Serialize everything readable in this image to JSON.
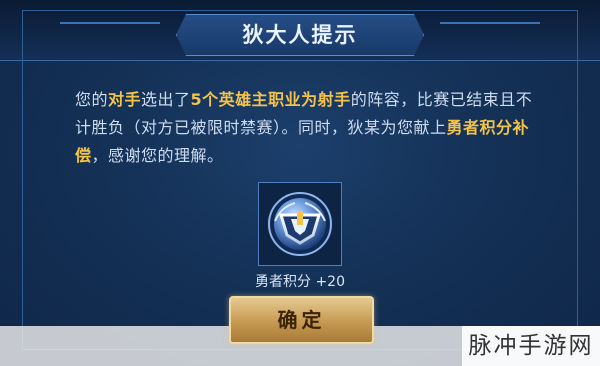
{
  "dialog": {
    "title": "狄大人提示",
    "message": {
      "p1": "您的",
      "h1": "对手",
      "p2": "选出了",
      "h2": "5个英雄主职业为射手",
      "p3": "的阵容，比赛已结束且不计胜负（对方已被限时禁赛）。同时，狄某为您献上",
      "h3": "勇者积分补偿",
      "p4": "，感谢您的理解。"
    },
    "reward": {
      "icon": "brave-points-badge-icon",
      "label": "勇者积分 +20"
    },
    "confirm_label": "确定"
  },
  "watermark": "脉冲手游网",
  "colors": {
    "highlight": "#f3c34a",
    "panel": "#143156",
    "button": "#c69a52"
  }
}
